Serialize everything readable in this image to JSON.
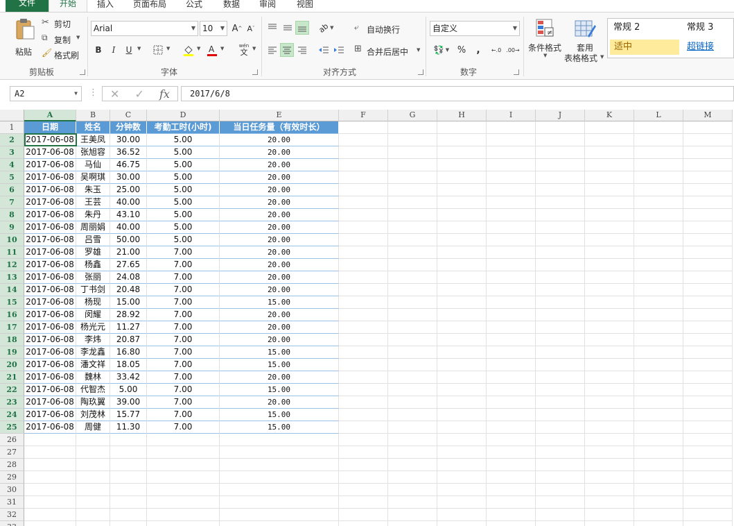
{
  "tabs": [
    "文件",
    "开始",
    "插入",
    "页面布局",
    "公式",
    "数据",
    "审阅",
    "视图"
  ],
  "clipboard": {
    "paste": "粘贴",
    "cut": "剪切",
    "copy": "复制",
    "format_painter": "格式刷",
    "group": "剪贴板"
  },
  "font": {
    "name": "Arial",
    "size": "10",
    "bold": "B",
    "italic": "I",
    "underline": "U",
    "group": "字体",
    "wen": "wén",
    "wen_char": "文"
  },
  "alignment": {
    "wrap": "自动换行",
    "merge": "合并后居中",
    "group": "对齐方式"
  },
  "number": {
    "format": "自定义",
    "percent": "%",
    "comma": ",",
    "group": "数字"
  },
  "style_buttons": {
    "conditional": "条件格式",
    "table_line1": "套用",
    "table_line2": "表格格式"
  },
  "styles_gallery": {
    "normal2": "常规 2",
    "normal3": "常规 3",
    "neutral": "适中",
    "hyperlink": "超链接"
  },
  "formula_bar": {
    "name_box": "A2",
    "value": "2017/6/8",
    "fx": "fx"
  },
  "grid": {
    "columns": [
      "A",
      "B",
      "C",
      "D",
      "E",
      "F",
      "G",
      "H",
      "I",
      "J",
      "K",
      "L",
      "M"
    ],
    "selected_cell": "A2",
    "headers": [
      "日期",
      "姓名",
      "分钟数",
      "考勤工时(小时)",
      "当日任务量（有效时长）"
    ],
    "rows": [
      [
        "2017-06-08",
        "王美凤",
        "30.00",
        "5.00",
        "20.00"
      ],
      [
        "2017-06-08",
        "张旭容",
        "36.52",
        "5.00",
        "20.00"
      ],
      [
        "2017-06-08",
        "马仙",
        "46.75",
        "5.00",
        "20.00"
      ],
      [
        "2017-06-08",
        "吴啊琪",
        "30.00",
        "5.00",
        "20.00"
      ],
      [
        "2017-06-08",
        "朱玉",
        "25.00",
        "5.00",
        "20.00"
      ],
      [
        "2017-06-08",
        "王芸",
        "40.00",
        "5.00",
        "20.00"
      ],
      [
        "2017-06-08",
        "朱丹",
        "43.10",
        "5.00",
        "20.00"
      ],
      [
        "2017-06-08",
        "周丽娟",
        "40.00",
        "5.00",
        "20.00"
      ],
      [
        "2017-06-08",
        "吕雪",
        "50.00",
        "5.00",
        "20.00"
      ],
      [
        "2017-06-08",
        "罗雄",
        "21.00",
        "7.00",
        "20.00"
      ],
      [
        "2017-06-08",
        "杨鑫",
        "27.65",
        "7.00",
        "20.00"
      ],
      [
        "2017-06-08",
        "张丽",
        "24.08",
        "7.00",
        "20.00"
      ],
      [
        "2017-06-08",
        "丁书剑",
        "20.48",
        "7.00",
        "20.00"
      ],
      [
        "2017-06-08",
        "杨现",
        "15.00",
        "7.00",
        "15.00"
      ],
      [
        "2017-06-08",
        "闵耀",
        "28.92",
        "7.00",
        "20.00"
      ],
      [
        "2017-06-08",
        "杨光元",
        "11.27",
        "7.00",
        "20.00"
      ],
      [
        "2017-06-08",
        "李炜",
        "20.87",
        "7.00",
        "20.00"
      ],
      [
        "2017-06-08",
        "李龙鑫",
        "16.80",
        "7.00",
        "15.00"
      ],
      [
        "2017-06-08",
        "潘文祥",
        "18.05",
        "7.00",
        "15.00"
      ],
      [
        "2017-06-08",
        "魏林",
        "33.42",
        "7.00",
        "20.00"
      ],
      [
        "2017-06-08",
        "代智杰",
        "5.00",
        "7.00",
        "15.00"
      ],
      [
        "2017-06-08",
        "陶玖翼",
        "39.00",
        "7.00",
        "20.00"
      ],
      [
        "2017-06-08",
        "刘茂林",
        "15.77",
        "7.00",
        "15.00"
      ],
      [
        "2017-06-08",
        "周健",
        "11.30",
        "7.00",
        "15.00"
      ]
    ],
    "row_numbers": [
      "1",
      "2",
      "3",
      "4",
      "5",
      "6",
      "7",
      "8",
      "9",
      "10",
      "11",
      "12",
      "13",
      "14",
      "15",
      "16",
      "17",
      "18",
      "19",
      "20",
      "21",
      "22",
      "23",
      "24",
      "25",
      "26",
      "27",
      "28",
      "29",
      "30",
      "31",
      "32",
      "33"
    ]
  },
  "colors": {
    "accent": "#217346",
    "header_fill": "#5b9bd5",
    "neutral_fill": "#ffeb9c",
    "hyperlink": "#0563c1"
  }
}
